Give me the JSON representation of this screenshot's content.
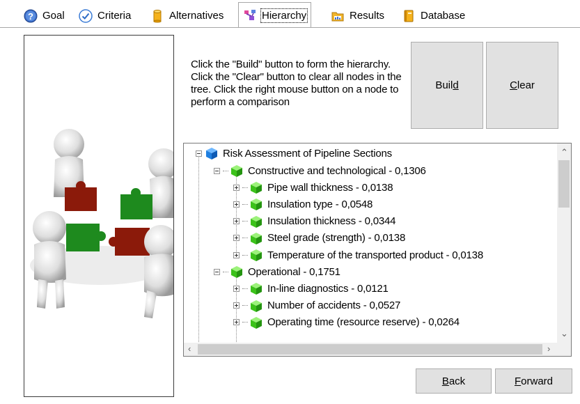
{
  "tabs": [
    {
      "label": "Goal",
      "icon": "help-icon"
    },
    {
      "label": "Criteria",
      "icon": "check-circle-icon"
    },
    {
      "label": "Alternatives",
      "icon": "database-cylinder-icon"
    },
    {
      "label": "Hierarchy",
      "icon": "hierarchy-icon",
      "active": true
    },
    {
      "label": "Results",
      "icon": "folder-chart-icon"
    },
    {
      "label": "Database",
      "icon": "book-icon"
    }
  ],
  "instructions": "Click the \"Build\" button to form the hierarchy. Click the \"Clear\" button to clear all nodes in the tree. Click the right mouse button on a node to perform a comparison",
  "buttons": {
    "build_pre": "Buil",
    "build_key": "d",
    "clear_key": "C",
    "clear_post": "lear",
    "back_key": "B",
    "back_post": "ack",
    "forward_key": "F",
    "forward_post": "orward"
  },
  "tree": {
    "root": "Risk Assessment of Pipeline Sections",
    "nodes": [
      {
        "label": "Constructive and technological - 0,1306",
        "level": 1,
        "expanded": true
      },
      {
        "label": "Pipe wall thickness - 0,0138",
        "level": 2
      },
      {
        "label": "Insulation type - 0,0548",
        "level": 2
      },
      {
        "label": "Insulation thickness - 0,0344",
        "level": 2
      },
      {
        "label": "Steel grade (strength) - 0,0138",
        "level": 2
      },
      {
        "label": "Temperature of the transported product - 0,0138",
        "level": 2
      },
      {
        "label": "Operational - 0,1751",
        "level": 1,
        "expanded": true
      },
      {
        "label": "In-line diagnostics - 0,0121",
        "level": 2
      },
      {
        "label": "Number of accidents - 0,0527",
        "level": 2
      },
      {
        "label": "Operating time (resource reserve) - 0,0264",
        "level": 2
      }
    ]
  },
  "colors": {
    "button_face": "#e1e1e1",
    "cube_green": "#3cc21a",
    "cube_blue": "#1f7fe0",
    "puzzle_red": "#8b1a0a",
    "puzzle_green": "#1e8a1e"
  }
}
